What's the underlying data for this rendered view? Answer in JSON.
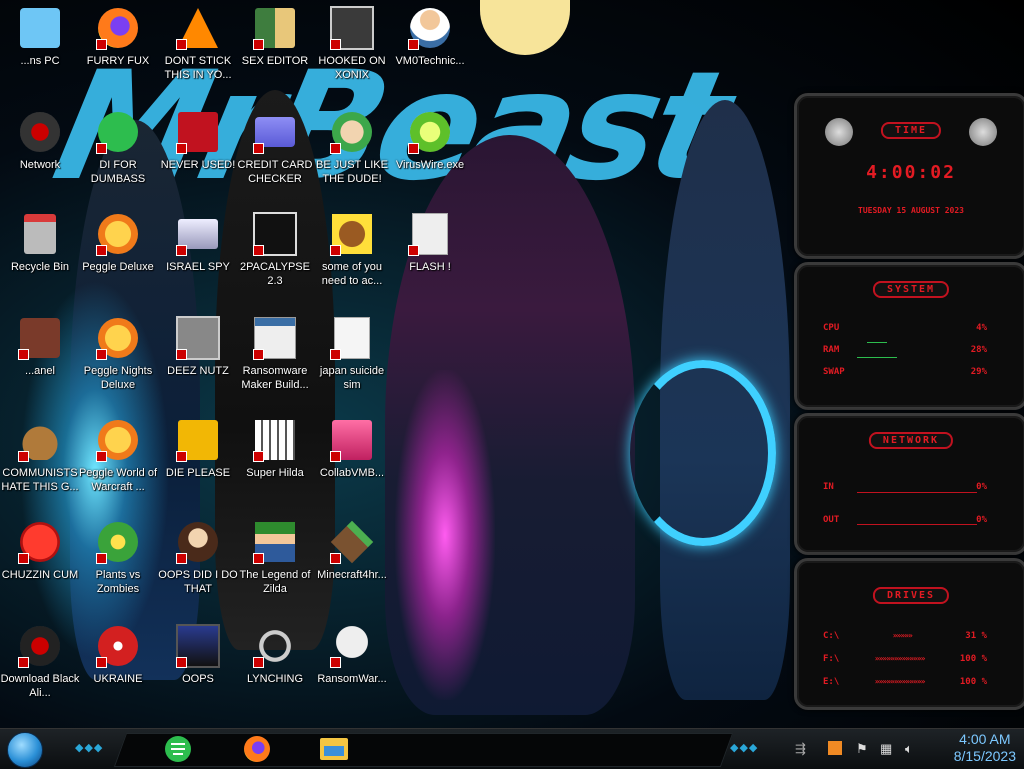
{
  "desktop": {
    "icons": [
      {
        "label": "...ns PC",
        "icon": "pc-icon"
      },
      {
        "label": "FURRY FUX",
        "icon": "firefox-icon"
      },
      {
        "label": "DONT STICK THIS IN YO...",
        "icon": "vlc-icon"
      },
      {
        "label": "SEX EDITOR",
        "icon": "hxd-editor-icon"
      },
      {
        "label": "HOOKED ON XONIX",
        "icon": "xonix-game-icon"
      },
      {
        "label": "VM0Technic...",
        "icon": "technician-icon"
      },
      {
        "label": "Network",
        "icon": "network-icon"
      },
      {
        "label": "DI FOR DUMBASS",
        "icon": "chat-icon"
      },
      {
        "label": "NEVER USED!",
        "icon": "dev-cpp-icon"
      },
      {
        "label": "CREDIT CARD CHECKER",
        "icon": "credit-card-icon"
      },
      {
        "label": "BE JUST LIKE THE DUDE!",
        "icon": "old-man-icon"
      },
      {
        "label": "VirusWire.exe",
        "icon": "lime-icon"
      },
      {
        "label": "Recycle Bin",
        "icon": "recycle-bin-icon"
      },
      {
        "label": "Peggle Deluxe",
        "icon": "peggle-icon"
      },
      {
        "label": "ISRAEL SPY",
        "icon": "spy-tool-icon"
      },
      {
        "label": "2PACALYPSE 2.3",
        "icon": "terminal-icon"
      },
      {
        "label": "some of you need to ac...",
        "icon": "beaver-icon"
      },
      {
        "label": "FLASH !",
        "icon": "flash-doc-icon"
      },
      {
        "label": "...anel",
        "icon": "control-panel-icon"
      },
      {
        "label": "Peggle Nights Deluxe",
        "icon": "peggle-icon"
      },
      {
        "label": "DEEZ NUTZ",
        "icon": "windows-stack-icon"
      },
      {
        "label": "Ransomware Maker Build...",
        "icon": "app-window-icon"
      },
      {
        "label": "japan suicide sim",
        "icon": "sim-doc-icon"
      },
      {
        "label": "COMMUNISTS HATE THIS G...",
        "icon": "money-bag-icon"
      },
      {
        "label": "Peggle World of Warcraft ...",
        "icon": "peggle-icon"
      },
      {
        "label": "DIE PLEASE",
        "icon": "de-letters-icon"
      },
      {
        "label": "Super Hilda",
        "icon": "pixel-game-icon"
      },
      {
        "label": "CollabVMB...",
        "icon": "computer-icon"
      },
      {
        "label": "CHUZZIN CUM",
        "icon": "chuzzle-icon"
      },
      {
        "label": "Plants vs Zombies",
        "icon": "flower-icon"
      },
      {
        "label": "OOPS DID I DO THAT",
        "icon": "portrait-icon"
      },
      {
        "label": "The Legend of Zilda",
        "icon": "pixel-hero-icon"
      },
      {
        "label": "Minecraft4hr...",
        "icon": "grass-block-icon"
      },
      {
        "label": "Download Black Ali...",
        "icon": "alien-ball-icon"
      },
      {
        "label": "UKRAINE",
        "icon": "radiation-icon"
      },
      {
        "label": "OOPS",
        "icon": "monitor-icon"
      },
      {
        "label": "LYNCHING",
        "icon": "noose-icon"
      },
      {
        "label": "RansomWar...",
        "icon": "skull-icon"
      }
    ]
  },
  "widgets": {
    "time": {
      "title": "TIME",
      "clock": "4:00:02",
      "date": "TUESDAY 15 AUGUST 2023"
    },
    "system": {
      "title": "SYSTEM",
      "rows": [
        {
          "name": "CPU",
          "value": "4%"
        },
        {
          "name": "RAM",
          "value": "28%"
        },
        {
          "name": "SWAP",
          "value": "29%"
        }
      ]
    },
    "network": {
      "title": "NETWORK",
      "rows": [
        {
          "name": "IN",
          "value": "0%"
        },
        {
          "name": "OUT",
          "value": "0%"
        }
      ]
    },
    "drives": {
      "title": "DRIVES",
      "rows": [
        {
          "name": "C:\\",
          "value": "31 %"
        },
        {
          "name": "F:\\",
          "value": "100 %"
        },
        {
          "name": "E:\\",
          "value": "100 %"
        }
      ]
    }
  },
  "taskbar": {
    "apps": [
      {
        "name": "chat-app",
        "icon": "chat-icon",
        "color": "#2dbd4e"
      },
      {
        "name": "firefox",
        "icon": "firefox-icon",
        "color": "#ff7a1a"
      },
      {
        "name": "file-explorer",
        "icon": "folder-icon",
        "color": "#f4c542"
      }
    ],
    "tray_icons": [
      "sound-card-icon",
      "flag-icon",
      "network-tray-icon",
      "volume-icon"
    ],
    "time": "4:00 AM",
    "date": "8/15/2023"
  },
  "colors": {
    "accent_red": "#e31b23",
    "accent_blue": "#39b7e6",
    "clock_blue": "#7cc8ff"
  }
}
